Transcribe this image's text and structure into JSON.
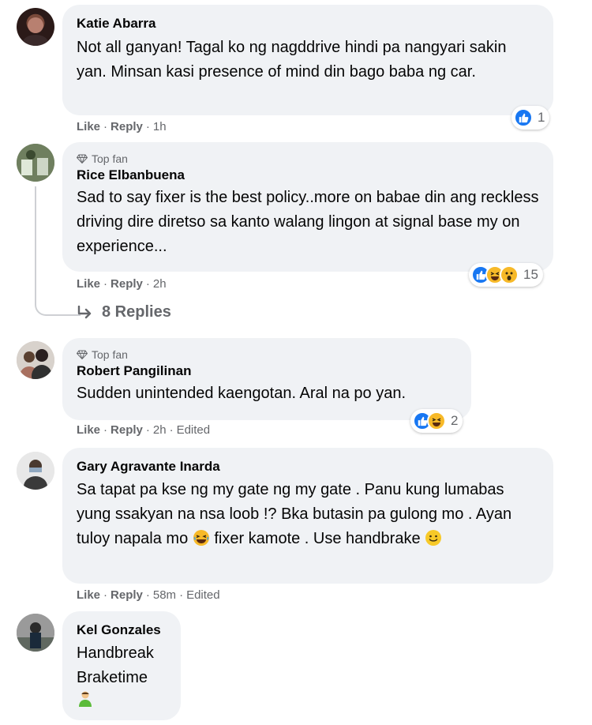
{
  "comments": [
    {
      "name": "Katie Abarra",
      "top_fan": "",
      "text": "Not all ganyan! Tagal ko ng nagddrive hindi pa nangyari sakin yan. Minsan kasi presence of mind din bago baba ng car.",
      "like": "Like",
      "reply": "Reply",
      "time": "1h",
      "edited": "",
      "reaction_count": "1",
      "reactions": [
        "like"
      ]
    },
    {
      "name": "Rice Elbanbuena",
      "top_fan": "Top fan",
      "text": "Sad to say fixer is the best policy..more on babae din ang reckless driving dire diretso sa kanto walang lingon at signal base my on experience...",
      "like": "Like",
      "reply": "Reply",
      "time": "2h",
      "edited": "",
      "reaction_count": "15",
      "reactions": [
        "like",
        "haha",
        "wow"
      ]
    },
    {
      "name": "Robert Pangilinan",
      "top_fan": "Top fan",
      "text": "Sudden unintended kaengotan. Aral na po yan.",
      "like": "Like",
      "reply": "Reply",
      "time": "2h",
      "edited": "Edited",
      "reaction_count": "2",
      "reactions": [
        "like",
        "haha"
      ]
    },
    {
      "name": "Gary Agravante Inarda",
      "top_fan": "",
      "text_line1": "Sa tapat pa kse ng my gate ng my gate . Panu kung lumabas yung ssakyan na nsa loob !? Bka butasin pa gulong mo . Ayan tuloy napala mo",
      "text_line2": "fixer kamote . Use handbrake",
      "like": "Like",
      "reply": "Reply",
      "time": "58m",
      "edited": "Edited"
    },
    {
      "name": "Kel Gonzales",
      "top_fan": "",
      "line1": "Handbreak",
      "line2": "Braketime"
    }
  ],
  "replies_label": "8 Replies",
  "colors": {
    "bubble": "#f0f2f5",
    "meta": "#65676b",
    "like_blue": "#1877f2",
    "emoji_yellow": "#f7b928"
  },
  "icons": [
    "diamond-icon",
    "reply-arrow-icon",
    "like-reaction-icon",
    "haha-reaction-icon",
    "wow-reaction-icon",
    "laughing-emoji-icon",
    "smile-emoji-icon",
    "person-emoji-icon"
  ]
}
